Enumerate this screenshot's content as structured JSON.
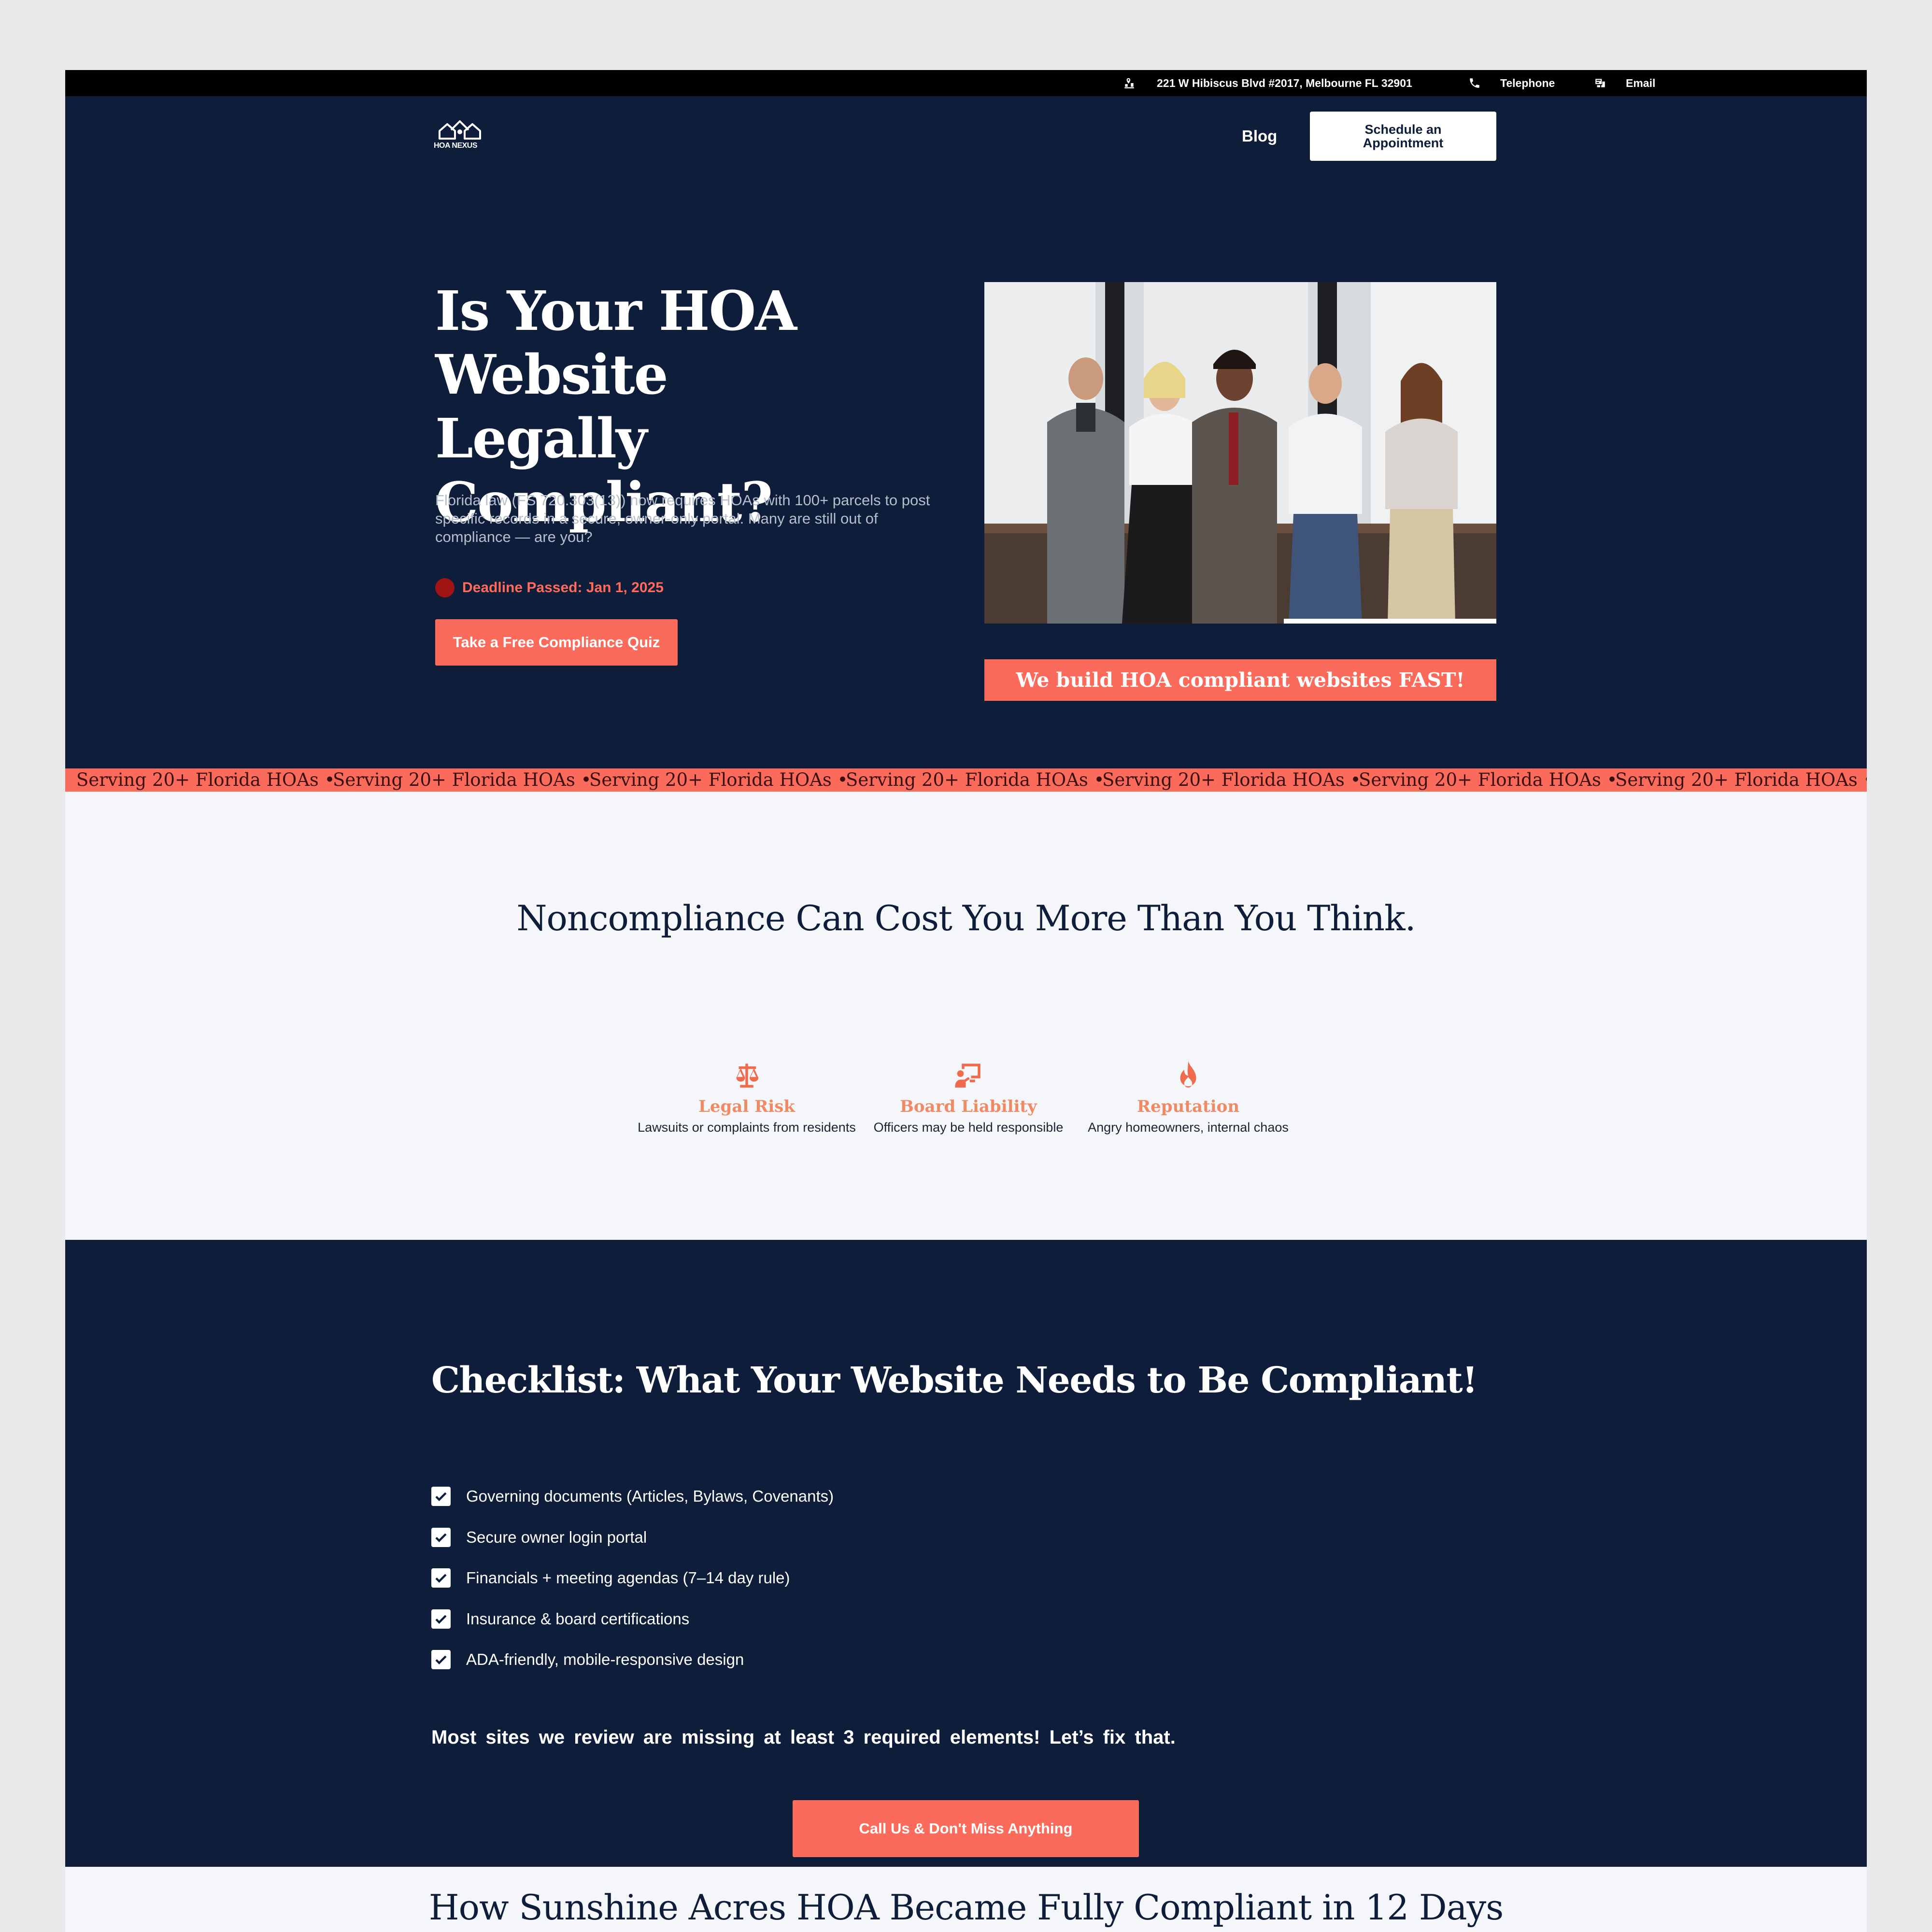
{
  "topbar": {
    "address": "221 W Hibiscus Blvd #2017, Melbourne FL 32901",
    "address_icon": "map-pin-icon",
    "phone_label": "Telephone",
    "phone_icon": "phone-icon",
    "email_label": "Email",
    "email_icon": "email-icon"
  },
  "header": {
    "logo_text": "HOA NEXUS",
    "nav_blog": "Blog",
    "cta_schedule": "Schedule an Appointment"
  },
  "hero": {
    "title": "Is Your HOA Website Legally Compliant?",
    "lead": "Florida law (FS 720.303(13)) now requires HOAs with 100+ parcels to post specific records in a secure, owner-only portal. Many are still out of compliance — are you?",
    "deadline": "Deadline Passed: Jan 1, 2025",
    "quiz_button": "Take a Free Compliance Quiz",
    "banner": "We build HOA compliant websites FAST!"
  },
  "ticker": {
    "items": [
      "Serving 20+ Florida HOAs •",
      "Serving 20+ Florida HOAs •",
      "Serving 20+ Florida HOAs •",
      "Serving 20+ Florida HOAs •",
      "Serving 20+ Florida HOAs •",
      "Serving 20+ Florida HOAs •",
      "Serving 20+ Florida HOAs •"
    ]
  },
  "risks": {
    "title": "Noncompliance Can Cost You More Than You Think.",
    "cards": [
      {
        "icon": "scale-icon",
        "title": "Legal Risk",
        "desc": "Lawsuits or complaints from residents"
      },
      {
        "icon": "board-presentation-icon",
        "title": "Board Liability",
        "desc": "Officers may be held responsible"
      },
      {
        "icon": "fire-icon",
        "title": "Reputation",
        "desc": "Angry homeowners, internal chaos"
      }
    ]
  },
  "checklist": {
    "title": "Checklist: What Your Website Needs to Be Compliant!",
    "items": [
      "Governing documents (Articles, Bylaws, Covenants)",
      "Secure owner login portal",
      "Financials + meeting agendas (7–14 day rule)",
      "Insurance & board certifications",
      "ADA-friendly, mobile-responsive design"
    ],
    "note": "Most sites we review are missing at least 3 required elements! Let’s fix that.",
    "cta": "Call Us & Don't Miss Anything"
  },
  "case_study": {
    "title": "How Sunshine Acres HOA Became Fully Compliant in 12 Days"
  },
  "colors": {
    "navy": "#0d1d3a",
    "coral": "#fb6b5b",
    "black": "#000000",
    "light_bg": "#f5f6f9"
  }
}
